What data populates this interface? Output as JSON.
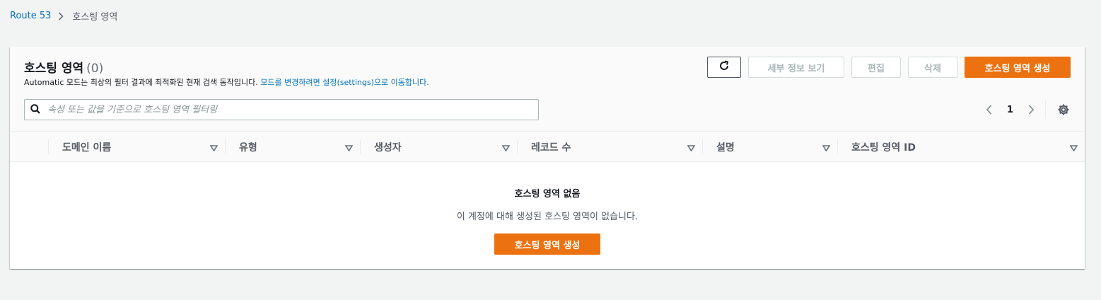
{
  "breadcrumb": {
    "root": "Route 53",
    "current": "호스팅 영역"
  },
  "panel": {
    "title": "호스팅 영역",
    "count": "(0)",
    "description_prefix": "Automatic 모드는 최상의 필터 결과에 최적화된 현재 검색 동작입니다.",
    "description_link": "모드를 변경하려면 설정(settings)으로 이동합니다."
  },
  "toolbar": {
    "details_label": "세부 정보 보기",
    "edit_label": "편집",
    "delete_label": "삭제",
    "create_label": "호스팅 영역 생성"
  },
  "search": {
    "placeholder": "속성 또는 값을 기준으로 호스팅 영역 필터링"
  },
  "pagination": {
    "current_page": "1"
  },
  "table": {
    "columns": [
      "도메인 이름",
      "유형",
      "생성자",
      "레코드 수",
      "설명",
      "호스팅 영역 ID"
    ]
  },
  "empty_state": {
    "title": "호스팅 영역 없음",
    "description": "이 계정에 대해 생성된 호스팅 영역이 없습니다.",
    "button_label": "호스팅 영역 생성"
  },
  "colors": {
    "primary": "#ec7211",
    "link": "#0073bb",
    "background": "#f2f3f3"
  }
}
